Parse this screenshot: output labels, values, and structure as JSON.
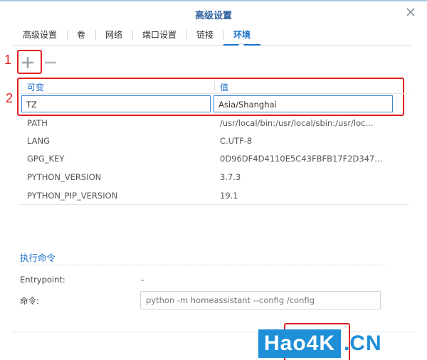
{
  "dialog": {
    "title": "高级设置",
    "close_icon": "close-icon"
  },
  "tabs": [
    {
      "label": "高级设置",
      "active": false
    },
    {
      "label": "卷",
      "active": false
    },
    {
      "label": "网络",
      "active": false
    },
    {
      "label": "端口设置",
      "active": false
    },
    {
      "label": "链接",
      "active": false
    },
    {
      "label": "环境",
      "active": true
    }
  ],
  "toolbar": {
    "add_icon": "plus-icon",
    "remove_icon": "minus-icon"
  },
  "annotations": {
    "label_1": "1",
    "label_2": "2",
    "color": "#e02020"
  },
  "env_table": {
    "headers": [
      "可变",
      "值"
    ],
    "rows": [
      {
        "name": "TZ",
        "value": "Asia/Shanghai",
        "editing": true
      },
      {
        "name": "PATH",
        "value": "/usr/local/bin:/usr/local/sbin:/usr/loc..."
      },
      {
        "name": "LANG",
        "value": "C.UTF-8"
      },
      {
        "name": "GPG_KEY",
        "value": "0D96DF4D4110E5C43FBFB17F2D347..."
      },
      {
        "name": "PYTHON_VERSION",
        "value": "3.7.3"
      },
      {
        "name": "PYTHON_PIP_VERSION",
        "value": "19.1"
      }
    ]
  },
  "execute": {
    "section_title": "执行命令",
    "entrypoint_label": "Entrypoint:",
    "entrypoint_value": "-",
    "command_label": "命令:",
    "command_placeholder": "python -m homeassistant --config /config"
  },
  "watermark": {
    "brand": "Hao4K",
    "dot": ".",
    "suffix": "CN"
  },
  "colors": {
    "accent": "#1a70c8",
    "title": "#2c5f9e",
    "watermark": "#1f8fd8"
  }
}
